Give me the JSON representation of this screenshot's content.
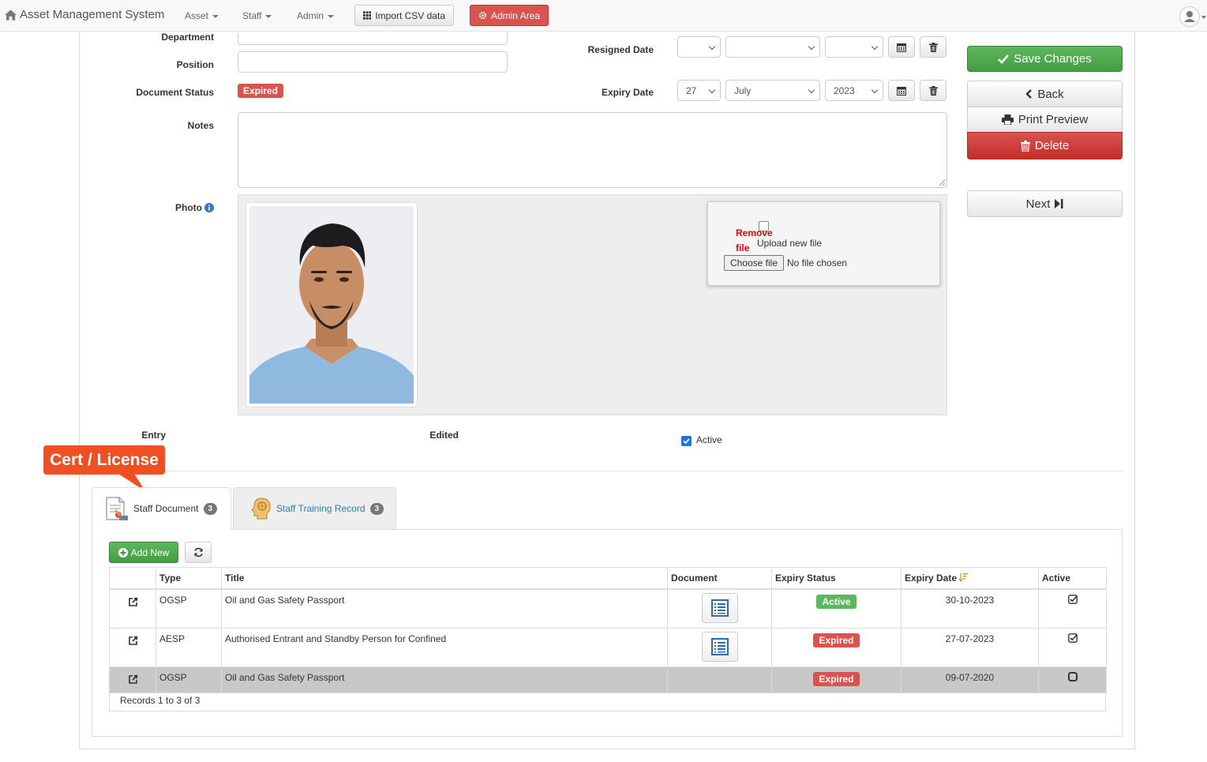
{
  "navbar": {
    "brand": "Asset Management System",
    "menus": [
      {
        "label": "Asset"
      },
      {
        "label": "Staff"
      },
      {
        "label": "Admin"
      }
    ],
    "import_label": "Import CSV data",
    "admin_area_label": "Admin Area"
  },
  "form": {
    "department_label": "Department",
    "position_label": "Position",
    "document_status_label": "Document Status",
    "document_status_value": "Expired",
    "notes_label": "Notes",
    "photo_label": "Photo",
    "resigned_date_label": "Resigned Date",
    "resigned_day": "",
    "resigned_month": "",
    "resigned_year": "",
    "expiry_date_label": "Expiry Date",
    "expiry_day": "27",
    "expiry_month": "July",
    "expiry_year": "2023",
    "entry_label": "Entry",
    "edited_label": "Edited",
    "active_label": "Active",
    "active_checked": true
  },
  "upload": {
    "remove_file": "Remove file",
    "upload_new_file": "Upload new file",
    "choose_file": "Choose file",
    "no_file_chosen": "No file chosen"
  },
  "actions": {
    "save": "Save Changes",
    "back": "Back",
    "print": "Print Preview",
    "delete": "Delete",
    "next": "Next"
  },
  "callout": "Cert / License",
  "tabs": [
    {
      "label": "Staff Document",
      "count": "3"
    },
    {
      "label": "Staff Training Record",
      "count": "3"
    }
  ],
  "toolbar": {
    "add_new": "Add New"
  },
  "table": {
    "columns": [
      "",
      "Type",
      "Title",
      "Document",
      "Expiry Status",
      "Expiry Date",
      "Active"
    ],
    "rows": [
      {
        "type": "OGSP",
        "title": "Oil and Gas Safety Passport",
        "status": "Active",
        "status_color": "#5cb85c",
        "expiry": "30-10-2023",
        "active": true,
        "has_doc": true
      },
      {
        "type": "AESP",
        "title": "Authorised Entrant and Standby Person for Confined",
        "status": "Expired",
        "status_color": "#d9534f",
        "expiry": "27-07-2023",
        "active": true,
        "has_doc": true
      },
      {
        "type": "OGSP",
        "title": "Oil and Gas Safety Passport",
        "status": "Expired",
        "status_color": "#d9534f",
        "expiry": "09-07-2020",
        "active": false,
        "has_doc": false
      }
    ],
    "footer": "Records 1 to 3 of 3"
  },
  "colors": {
    "primary_green": "#5cb85c",
    "danger_red": "#d9534f",
    "callout_orange": "#f04e23",
    "link_blue": "#337ab7"
  }
}
